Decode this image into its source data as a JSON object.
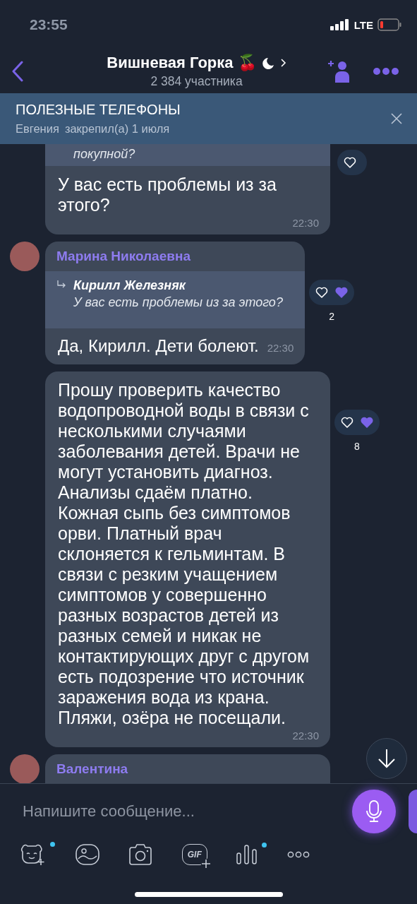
{
  "status_bar": {
    "time": "23:55",
    "network": "LTE",
    "battery_low": true
  },
  "header": {
    "title": "Вишневая Горка 🍒",
    "muted": true,
    "subtitle": "2 384 участника"
  },
  "pinned": {
    "title": "ПОЛЕЗНЫЕ ТЕЛЕФОНЫ",
    "author": "Евгения",
    "meta": "закрепил(а) 1 июля"
  },
  "messages": [
    {
      "kind": "continued",
      "quote_text": "покупной?",
      "text": "У вас есть проблемы из за этого?",
      "time": "22:30",
      "reaction": {
        "liked": false
      }
    },
    {
      "kind": "reply",
      "author": "Марина Николаевна",
      "quote_author": "Кирилл Железняк",
      "quote_text": "У вас есть проблемы из за этого?",
      "text": "Да, Кирилл. Дети болеют.",
      "time": "22:30",
      "reaction": {
        "liked": true,
        "count": "2"
      }
    },
    {
      "kind": "plain",
      "text": "Прошу проверить качество водопроводной воды в связи с несколькими случаями заболевания детей. Врачи не могут установить диагноз. Анализы сдаём платно. Кожная сыпь без симптомов орви. Платный врач склоняется к гельминтам. В связи с резким учащением симптомов у совершенно разных возрастов детей из разных семей и никак не контактирующих друг с другом есть подозрение что источник заражения вода из крана. Пляжи, озёра не посещали.",
      "time": "22:30",
      "reaction": {
        "liked": true,
        "count": "8"
      }
    },
    {
      "kind": "cut",
      "author": "Валентина"
    }
  ],
  "composer": {
    "placeholder": "Напишите сообщение..."
  },
  "toolbar": [
    {
      "kind": "sticker",
      "badge": true
    },
    {
      "kind": "gallery",
      "badge": false
    },
    {
      "kind": "camera",
      "badge": false
    },
    {
      "kind": "gif",
      "label": "GIF",
      "badge": false
    },
    {
      "kind": "audio",
      "badge": true
    },
    {
      "kind": "more",
      "badge": false
    }
  ]
}
